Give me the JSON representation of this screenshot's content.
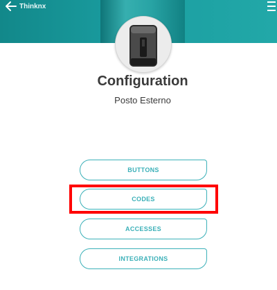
{
  "header": {
    "back_title": "Thinknx"
  },
  "profile": {
    "title": "Configuration",
    "subtitle": "Posto Esterno"
  },
  "menu_buttons": [
    {
      "label": "BUTTONS"
    },
    {
      "label": "CODES"
    },
    {
      "label": "ACCESSES"
    },
    {
      "label": "INTEGRATIONS"
    }
  ],
  "colors": {
    "header_teal": "#1a9da0",
    "button_accent": "#3bb0b8",
    "highlight": "#ff0000",
    "text": "#3a3a3a"
  },
  "icons": {
    "back": "arrow-left-icon",
    "menu": "hamburger-menu-icon",
    "device": "intercom-device-image"
  }
}
